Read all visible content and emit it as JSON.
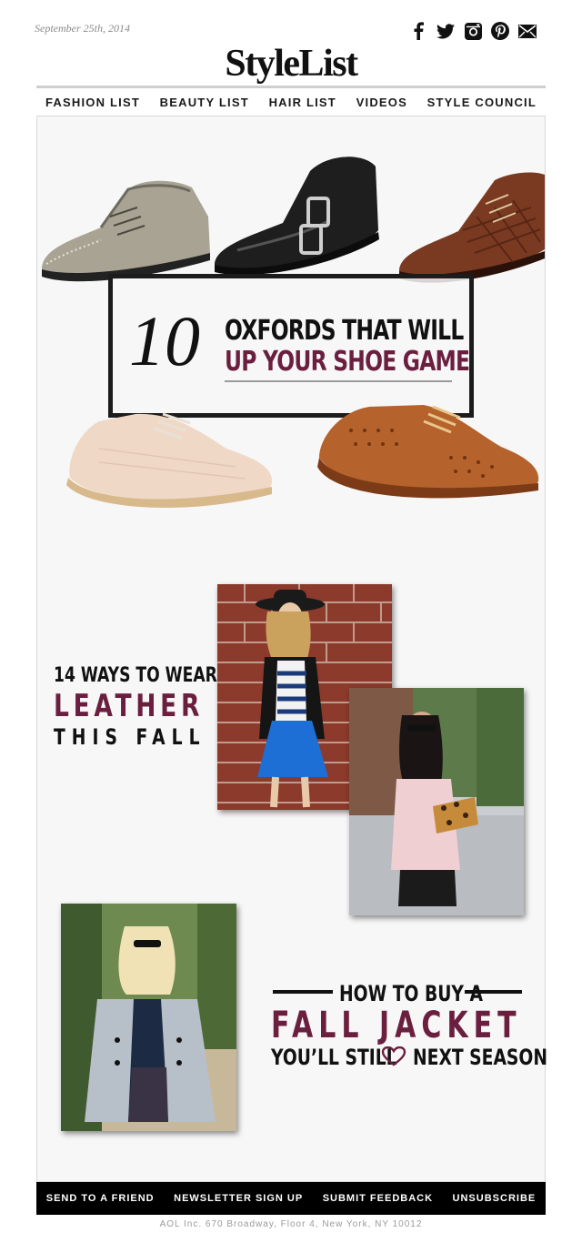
{
  "header": {
    "date": "September 25th, 2014",
    "logo": "StyleList",
    "social": [
      "facebook-icon",
      "twitter-icon",
      "instagram-icon",
      "pinterest-icon",
      "mail-icon"
    ]
  },
  "nav": [
    "FASHION LIST",
    "BEAUTY LIST",
    "HAIR LIST",
    "VIDEOS",
    "STYLE COUNCIL"
  ],
  "hero": {
    "number": "10",
    "line1": "OXFORDS THAT WILL",
    "line2": "UP YOUR SHOE GAME"
  },
  "leather": {
    "line1": "14 WAYS TO WEAR",
    "line2": "LEATHER",
    "line3": "THIS FALL"
  },
  "jacket": {
    "line1": "HOW TO BUY A",
    "line2": "FALL JACKET",
    "line3a": "YOU’LL STILL",
    "line3b": "NEXT SEASON"
  },
  "footer": {
    "links": [
      "SEND TO A FRIEND",
      "NEWSLETTER SIGN UP",
      "SUBMIT FEEDBACK",
      "UNSUBSCRIBE"
    ],
    "address": "AOL Inc. 670 Broadway, Floor 4, New York, NY 10012"
  },
  "colors": {
    "accent": "#6b1f3f",
    "text": "#111111",
    "background": "#f7f7f7"
  }
}
